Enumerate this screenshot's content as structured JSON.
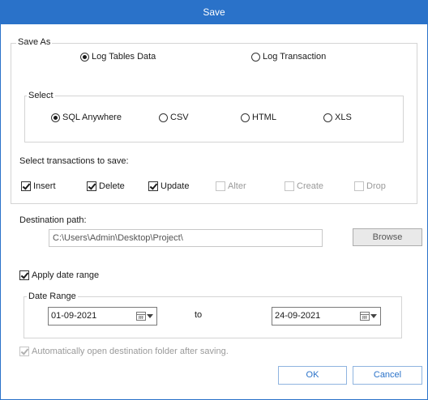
{
  "window": {
    "title": "Save"
  },
  "save_as": {
    "label": "Save As",
    "options": [
      {
        "label": "Log Tables Data",
        "selected": true
      },
      {
        "label": "Log Transaction",
        "selected": false
      }
    ]
  },
  "select": {
    "label": "Select",
    "options": [
      {
        "label": "SQL Anywhere",
        "selected": true
      },
      {
        "label": "CSV",
        "selected": false
      },
      {
        "label": "HTML",
        "selected": false
      },
      {
        "label": "XLS",
        "selected": false
      }
    ]
  },
  "transactions": {
    "label": "Select transactions to save:",
    "items": [
      {
        "label": "Insert",
        "checked": true,
        "enabled": true
      },
      {
        "label": "Delete",
        "checked": true,
        "enabled": true
      },
      {
        "label": "Update",
        "checked": true,
        "enabled": true
      },
      {
        "label": "Alter",
        "checked": false,
        "enabled": false
      },
      {
        "label": "Create",
        "checked": false,
        "enabled": false
      },
      {
        "label": "Drop",
        "checked": false,
        "enabled": false
      }
    ]
  },
  "destination": {
    "label": "Destination path:",
    "value": "C:\\Users\\Admin\\Desktop\\Project\\",
    "browse_label": "Browse"
  },
  "date_range": {
    "apply_label": "Apply date range",
    "apply_checked": true,
    "group_label": "Date Range",
    "from": "01-09-2021",
    "to_label": "to",
    "to": "24-09-2021"
  },
  "auto_open": {
    "label": "Automatically open destination folder after saving.",
    "checked": true,
    "enabled": false
  },
  "footer": {
    "ok_label": "OK",
    "cancel_label": "Cancel"
  }
}
